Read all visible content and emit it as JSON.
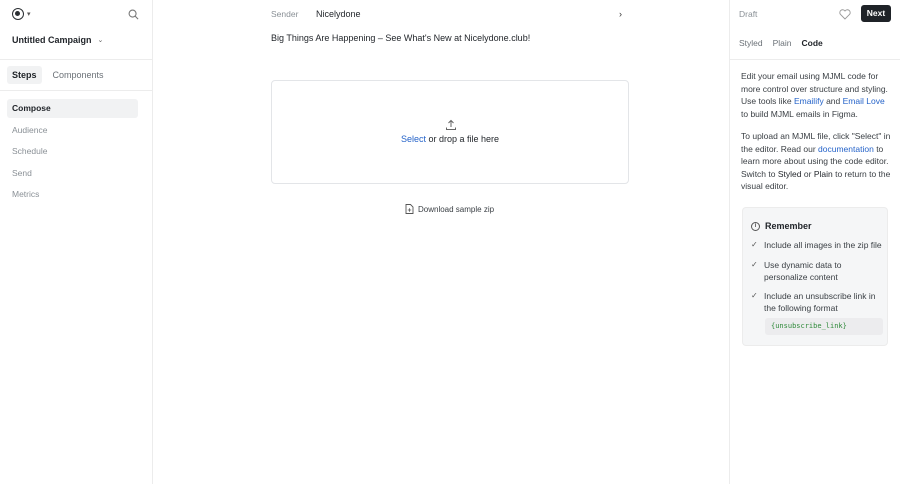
{
  "sidebar": {
    "campaign_name": "Untitled Campaign",
    "tabs": [
      {
        "label": "Steps",
        "active": true
      },
      {
        "label": "Components",
        "active": false
      }
    ],
    "steps": [
      {
        "label": "Compose",
        "active": true
      },
      {
        "label": "Audience",
        "active": false
      },
      {
        "label": "Schedule",
        "active": false
      },
      {
        "label": "Send",
        "active": false
      },
      {
        "label": "Metrics",
        "active": false
      }
    ]
  },
  "editor": {
    "sender_label": "Sender",
    "sender_value": "Nicelydone",
    "subject": "Big Things Are Happening – See What's New at Nicelydone.club!",
    "dropzone": {
      "select_link": "Select",
      "text": "or drop a file here"
    },
    "download_label": "Download sample zip"
  },
  "panel": {
    "status": "Draft",
    "next_label": "Next",
    "modes": [
      {
        "label": "Styled",
        "active": false
      },
      {
        "label": "Plain",
        "active": false
      },
      {
        "label": "Code",
        "active": true
      }
    ],
    "intro": {
      "t1": "Edit your email using MJML code for more control over structure and styling. Use tools like",
      "emailify": "Emailify",
      "and": "and",
      "email_love": "Email Love",
      "t2": "to build MJML emails in Figma."
    },
    "upload_help": {
      "t1": "To upload an MJML file, click \"Select\" in the editor. Read our",
      "documentation": "documentation",
      "t2": "to learn more about using the code editor. Switch to",
      "styled": "Styled",
      "or": "or",
      "plain": "Plain",
      "t3": "to return to the visual editor."
    },
    "remember": {
      "title": "Remember",
      "items": [
        "Include all images in the zip file",
        "Use dynamic data to personalize content",
        "Include an unsubscribe link in the following format"
      ],
      "code": "{unsubscribe_link}"
    }
  },
  "icons": {
    "workspace": "workspace-logo-icon",
    "search": "search-icon",
    "upload": "upload-icon",
    "document": "document-icon",
    "heart": "heart-icon",
    "info": "info-icon",
    "check": "check-icon"
  },
  "colors": {
    "accent": "#2563c9",
    "primary_button": "#1f2328",
    "code_text": "#2f8a3a"
  }
}
